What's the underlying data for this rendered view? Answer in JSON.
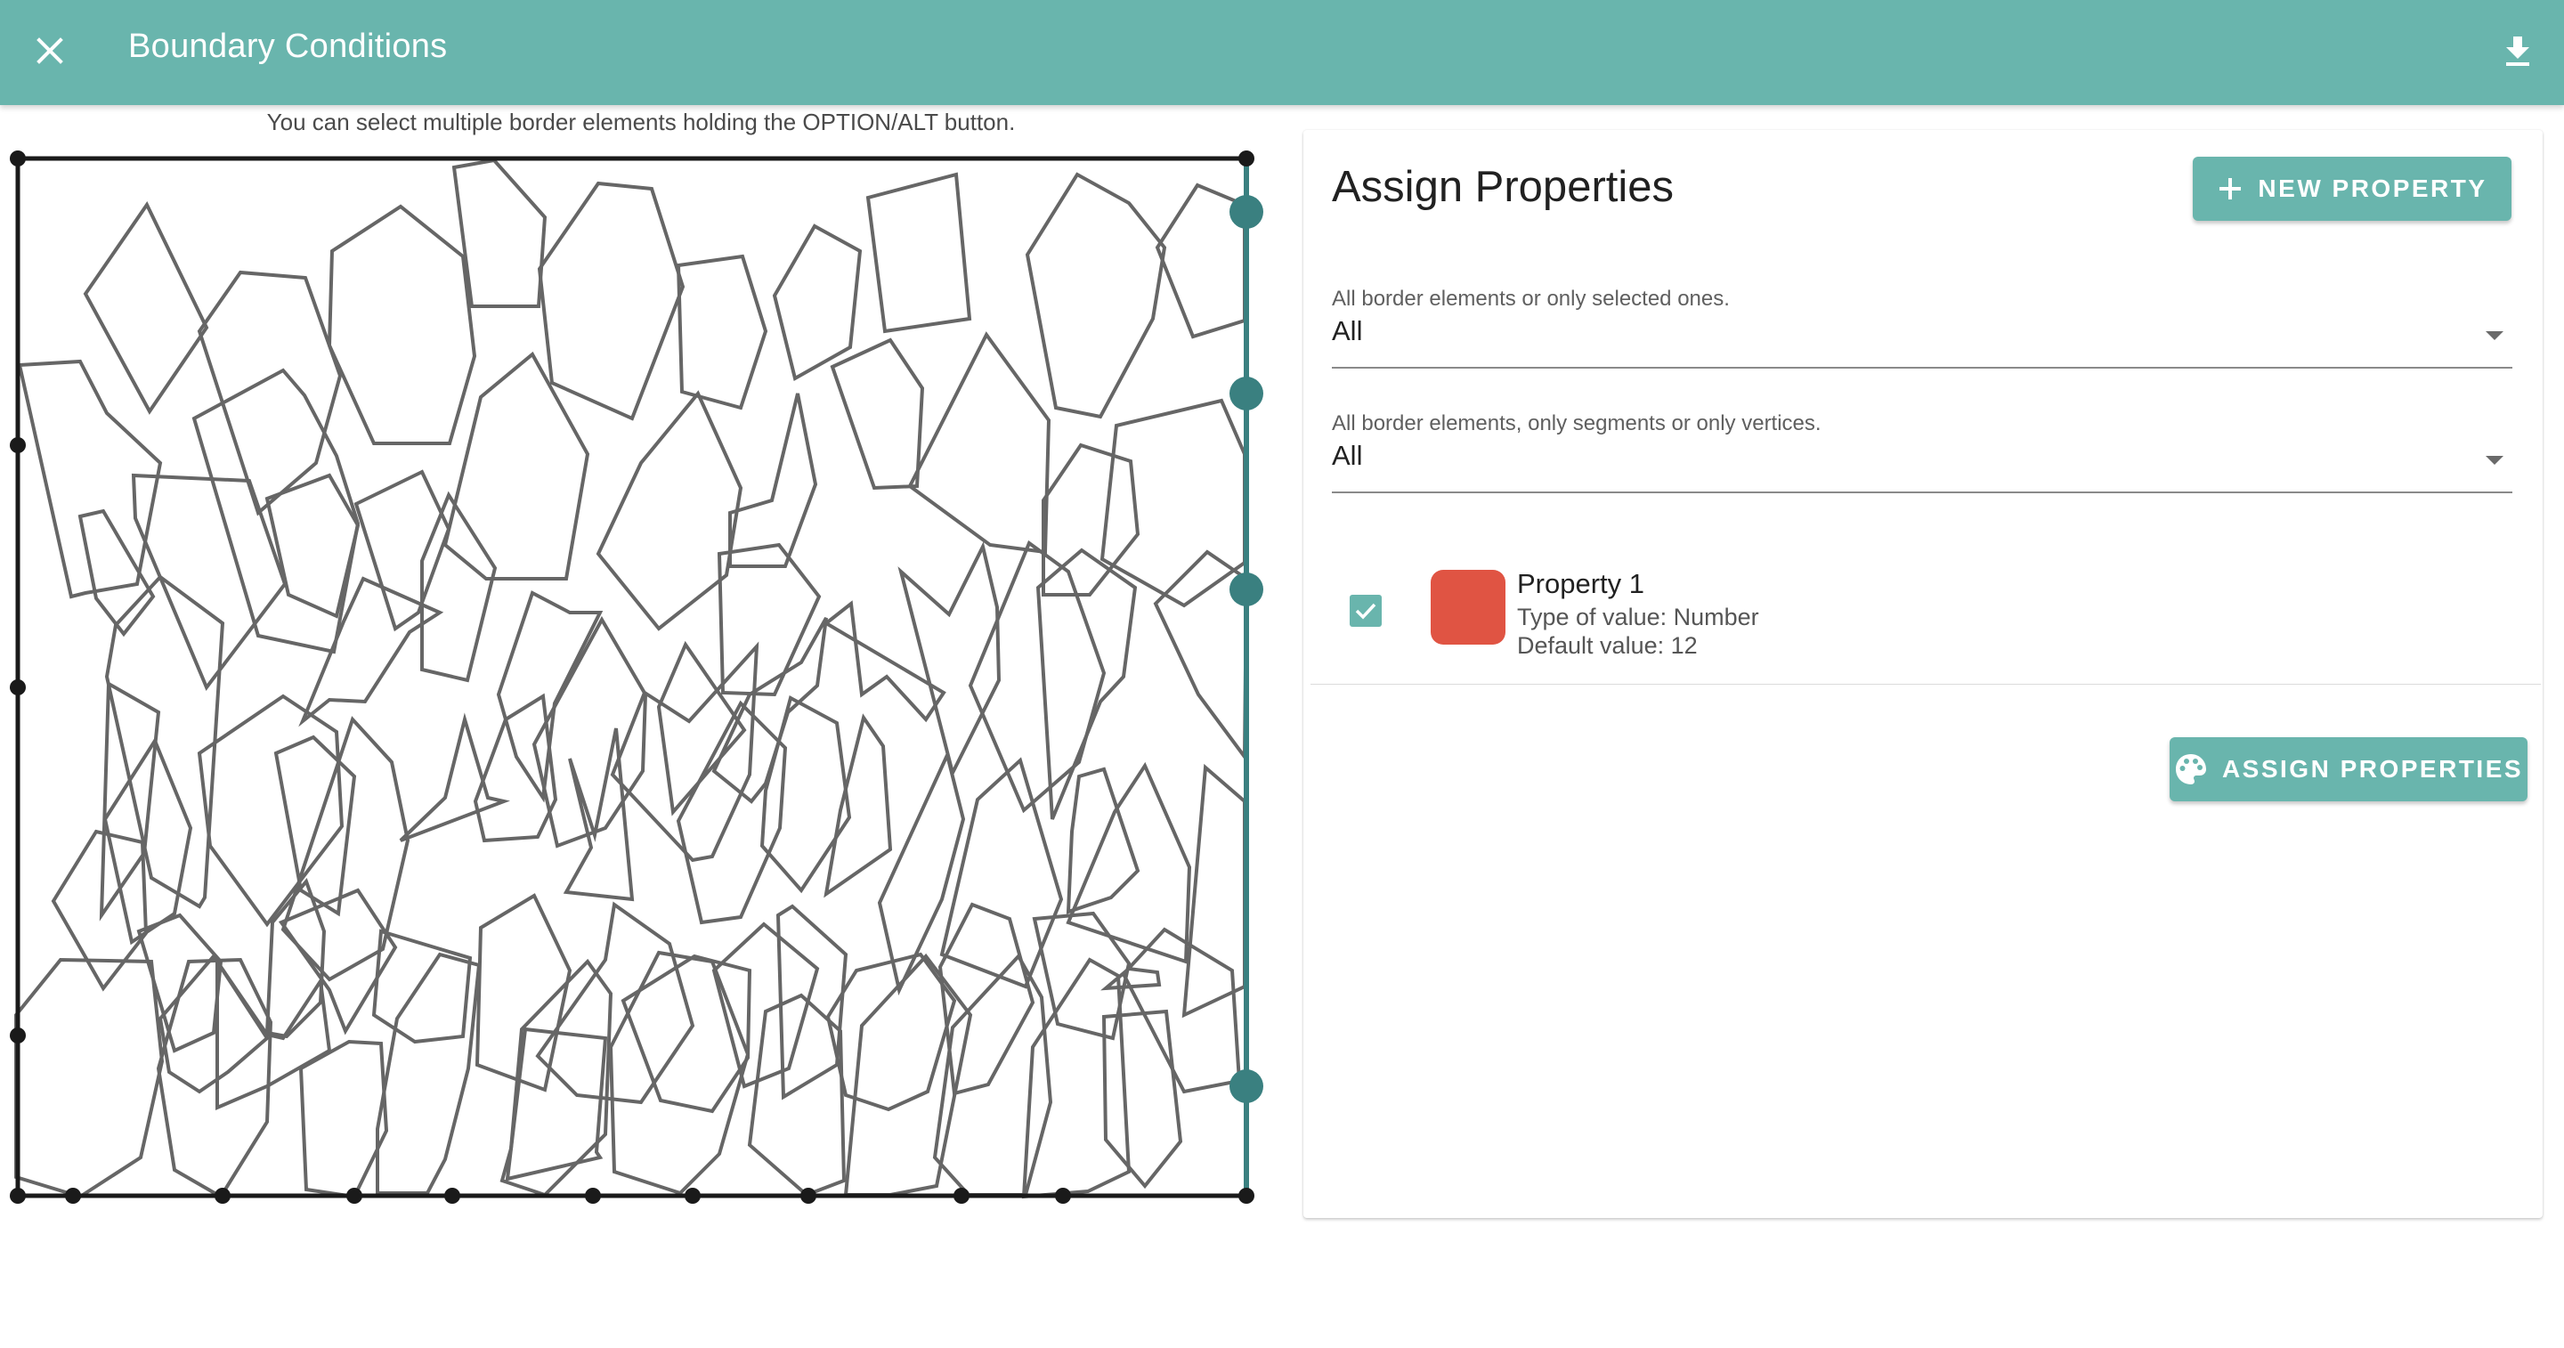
{
  "app": {
    "title": "Boundary Conditions",
    "close_icon": "close-icon",
    "download_icon": "download-icon",
    "accent_color": "#69b5ad"
  },
  "hint": "You can select multiple border elements holding the OPTION/ALT button.",
  "panel": {
    "heading": "Assign Properties",
    "new_property_label": "NEW PROPERTY",
    "selection_filter": {
      "label": "All border elements or only selected ones.",
      "value": "All"
    },
    "element_filter": {
      "label": "All border elements, only segments or only vertices.",
      "value": "All"
    },
    "properties": [
      {
        "name": "Property 1",
        "type_text": "Type of value: Number",
        "default_text": "Default value: 12",
        "color": "#e05443",
        "checked": true
      }
    ],
    "assign_label": "ASSIGN PROPERTIES"
  },
  "canvas": {
    "selected_color": "#3a8080",
    "border_color": "#1a1a1a",
    "cell_color": "#666666"
  }
}
